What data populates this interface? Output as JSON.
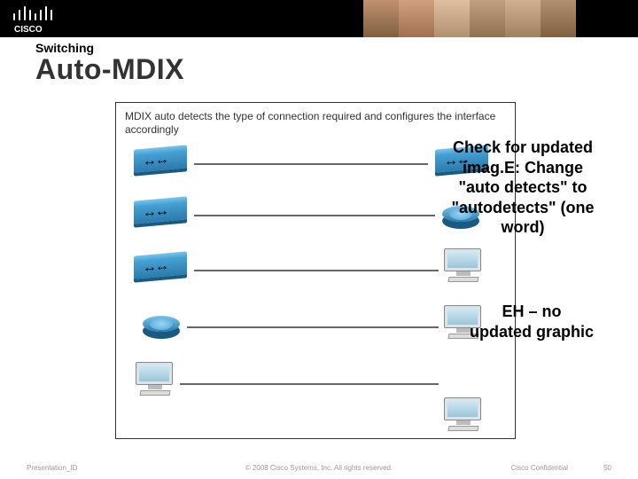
{
  "section_label": "Switching",
  "title": "Auto-MDIX",
  "figure_caption": "MDIX auto detects the type of connection required and configures the interface accordingly",
  "review_note_1": "Check for updated imag.E: Change \"auto detects\" to \"autodetects\" (one word)",
  "review_note_2": "EH – no updated graphic",
  "footer": {
    "left": "Presentation_ID",
    "center": "© 2008 Cisco Systems, Inc. All rights reserved.",
    "right_label": "Cisco Confidential",
    "page": "50"
  },
  "brand": "Cisco"
}
